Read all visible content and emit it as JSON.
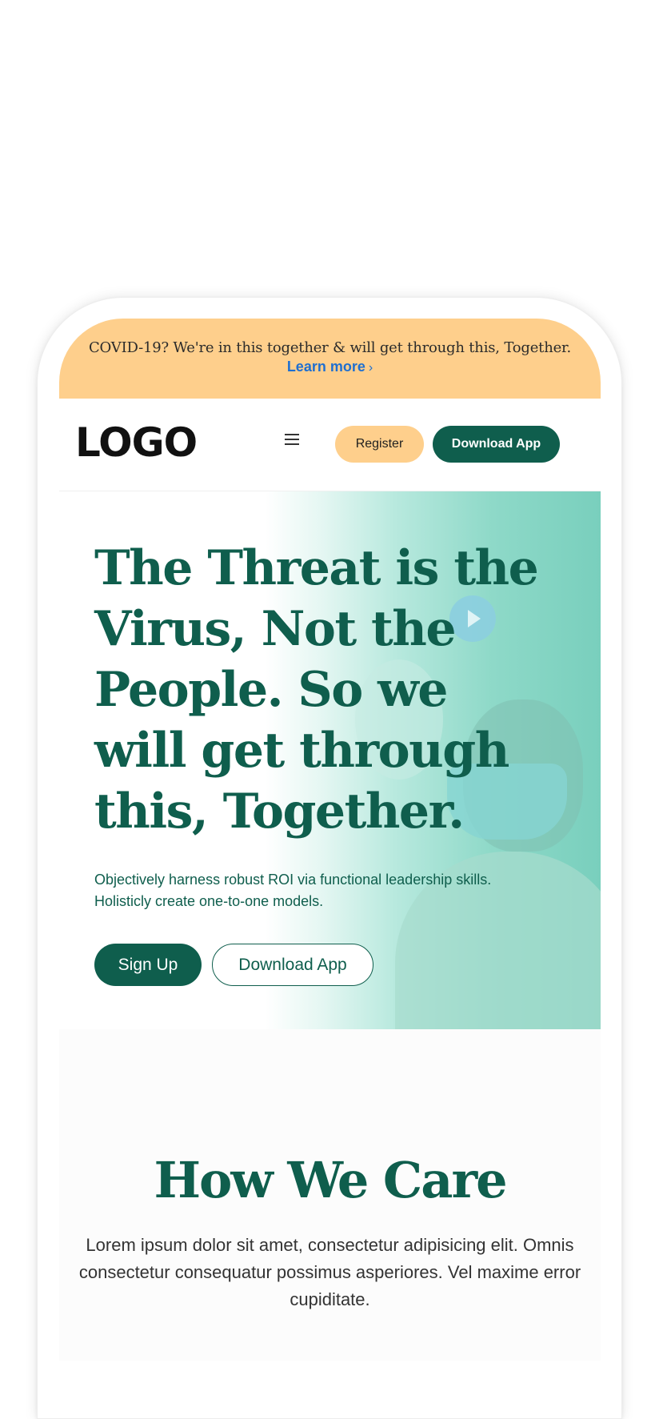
{
  "banner": {
    "text": "COVID-19? We're in this together & will get through this, Together.",
    "link_label": "Learn more",
    "link_chevron": "›"
  },
  "nav": {
    "logo": "LOGO",
    "menu_icon": "hamburger-menu-icon",
    "register_label": "Register",
    "download_label": "Download App"
  },
  "hero": {
    "title": "The Threat is the Virus, Not the People. So we will get through this, Together.",
    "subtitle": "Objectively harness robust ROI via functional leadership skills. Holisticly create one-to-one models.",
    "signup_label": "Sign Up",
    "download_label": "Download App",
    "play_icon": "play-icon"
  },
  "care": {
    "title": "How We Care",
    "text": "Lorem ipsum dolor sit amet, consectetur adipisicing elit. Omnis consectetur consequatur possimus asperiores. Vel maxime error cupiditate."
  },
  "colors": {
    "primary": "#0f5e4d",
    "accent": "#fecf8c",
    "link": "#1f6fd0",
    "hero_gradient_end": "#79cfbd"
  }
}
